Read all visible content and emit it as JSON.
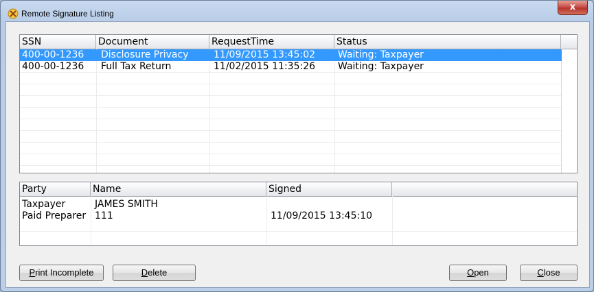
{
  "window": {
    "title": "Remote Signature Listing",
    "close_glyph": "x",
    "icon": "signature-pen-icon"
  },
  "requests": {
    "columns": [
      "SSN",
      "Document",
      "RequestTime",
      "Status"
    ],
    "rows": [
      {
        "ssn": "400-00-1236",
        "document": "Disclosure Privacy",
        "request_time": "11/09/2015 13:45:02",
        "status": "Waiting: Taxpayer",
        "selected": true
      },
      {
        "ssn": "400-00-1236",
        "document": "Full Tax Return",
        "request_time": "11/02/2015 11:35:26",
        "status": "Waiting: Taxpayer",
        "selected": false
      }
    ]
  },
  "parties": {
    "columns": [
      "Party",
      "Name",
      "Signed",
      ""
    ],
    "rows": [
      {
        "party": "Taxpayer",
        "name": "JAMES SMITH",
        "signed": ""
      },
      {
        "party": "Paid Preparer",
        "name": "111",
        "signed": "11/09/2015 13:45:10"
      }
    ]
  },
  "buttons": {
    "print_incomplete": {
      "mnemonic": "P",
      "rest": "rint Incomplete"
    },
    "delete": {
      "mnemonic": "D",
      "rest": "elete"
    },
    "open": {
      "mnemonic": "O",
      "rest": "pen"
    },
    "close": {
      "mnemonic": "C",
      "rest": "lose"
    }
  },
  "colors": {
    "selection": "#3399ff",
    "client_background": "#f0f0f0",
    "close_button": "#c75050"
  }
}
